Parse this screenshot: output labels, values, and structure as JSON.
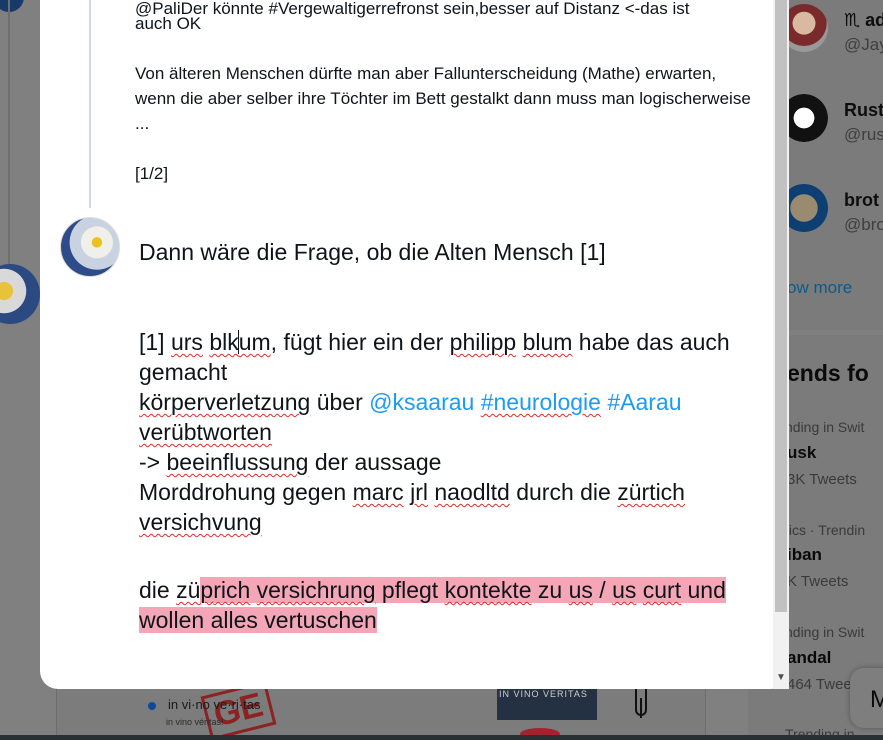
{
  "background": {
    "who_to_follow": [
      {
        "name": "♏ ad",
        "handle": "@Jay"
      },
      {
        "name": "Rust",
        "handle": "@rus"
      },
      {
        "name": "brot",
        "handle": "@bro"
      }
    ],
    "show_more": "ow more",
    "trends_title": "ends fo",
    "trends": [
      {
        "context": "nding in Swit",
        "name": "usk",
        "count": "3K Tweets"
      },
      {
        "context": "tics · Trendin",
        "name": "iban",
        "count": "K Tweets"
      },
      {
        "context": "nding in Swit",
        "name": "andal",
        "count": "464 Twee"
      },
      {
        "context": "Trending in",
        "name": "",
        "count": ""
      }
    ],
    "messages_glyph": "M",
    "card": {
      "title": "in vi·no ve·ri·tas",
      "subtitle": "in vino véritas!",
      "thumb_label": "IN VINO VERITAS",
      "stamp": "GE"
    }
  },
  "quoted_tweet": {
    "line1": "@PaliDer könnte #Vergewaltigerrefronst sein,besser auf Distanz <-das ist",
    "line2": "auch OK",
    "para2": "Von älteren Menschen dürfte man aber Fallunterscheidung (Mathe) erwarten, wenn die aber selber ihre Töchter im Bett gestalkt dann muss man logischerweise ...",
    "counter": "[1/2]"
  },
  "compose": {
    "line_intro": "Dann wäre die Frage, ob die Alten Mensch [1]",
    "p1": {
      "a": "[1] ",
      "urs": "urs",
      "space1": " ",
      "blk1": "blk",
      "blk2": "um",
      "b": ", fügt hier ein der ",
      "philipp": "philipp",
      "space2": " ",
      "blum": "blum",
      "c": " habe das auch gemacht"
    },
    "p2": {
      "koerper": "körperverletzung",
      "a": " über ",
      "mention": "@ksaarau",
      "space1": " ",
      "tag1": "#neurologie",
      "space2": " ",
      "tag2": "#Aarau",
      "space3": " ",
      "veruebt": "verübtworten"
    },
    "p3": {
      "a": "-> ",
      "beein": "beeinflussung",
      "b": " der aussage"
    },
    "p4": {
      "a": "Morddrohung gegen ",
      "marc": "marc",
      "space1": " ",
      "jrl": "jrl",
      "space2": " ",
      "naod": "naodltd",
      "b": " durch die ",
      "zuertich": "zürtich",
      "space3": " ",
      "versich": "versichvung"
    },
    "p5": {
      "a": "die ",
      "zue": "zü",
      "zue_hl": "p",
      "rich": "rich",
      "space1": " ",
      "versichrung": "versichrung",
      "b": " pflegt ",
      "kontekte": "kontekte",
      "c": " zu ",
      "us1": "us",
      "d": " / ",
      "us2": "us",
      "space2": " ",
      "curt": "curt",
      "e": " und wollen alles vertuschen"
    }
  },
  "colors": {
    "link": "#1d9bf0",
    "overflow_highlight": "#f4a6b7",
    "spell_underline": "#d93025",
    "text": "#0f1419"
  }
}
